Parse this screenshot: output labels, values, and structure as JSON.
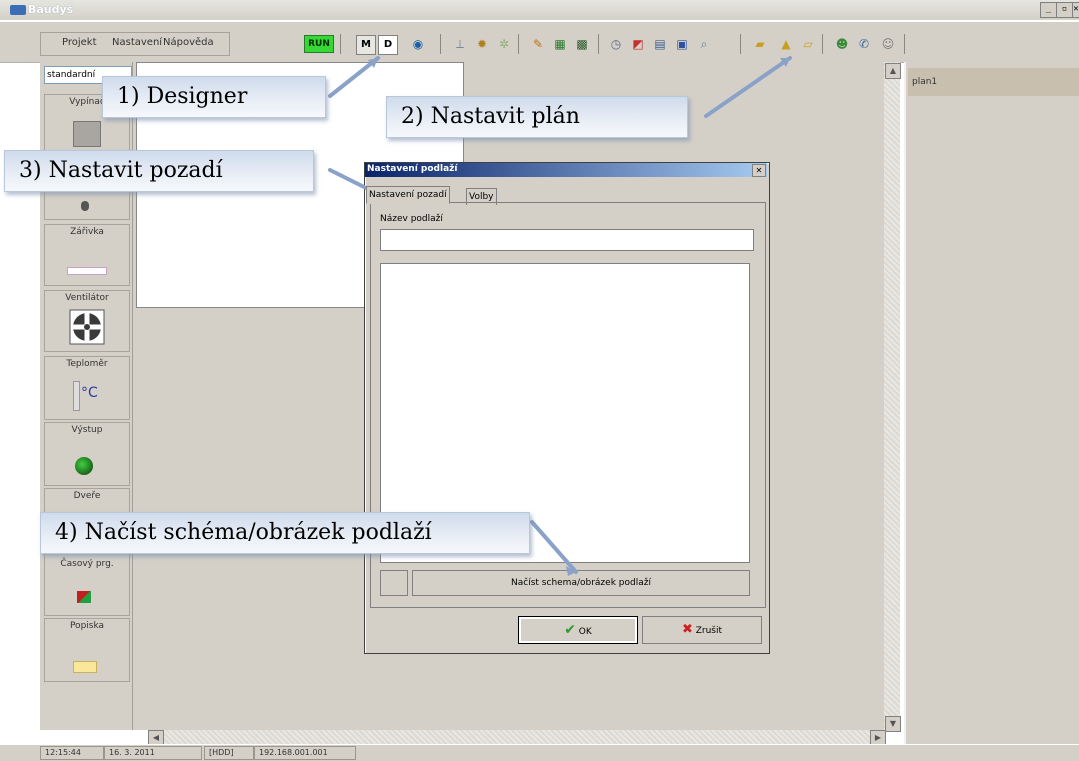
{
  "window": {
    "title": "Baudyš",
    "buttons": [
      "_",
      "▫",
      "✕"
    ]
  },
  "menu": {
    "items": [
      "Projekt",
      "Nastavení",
      "Nápověda"
    ]
  },
  "toolbar": {
    "run_label": "RUN",
    "m_label": "M",
    "d_label": "D"
  },
  "left_panel": {
    "dropdown_value": "standardní",
    "components": [
      {
        "label": "Vypínač",
        "icon": "switch-icon"
      },
      {
        "label": "",
        "icon": "bulb-icon"
      },
      {
        "label": "Zářivka",
        "icon": "fluorescent-lamp-icon"
      },
      {
        "label": "Ventilátor",
        "icon": "fan-icon"
      },
      {
        "label": "Teploměr",
        "icon": "thermometer-icon",
        "icon_text": "°C"
      },
      {
        "label": "Výstup",
        "icon": "output-led-icon"
      },
      {
        "label": "Dveře",
        "icon": "door-icon"
      },
      {
        "label": "Časový prg.",
        "icon": "timer-program-icon"
      },
      {
        "label": "Popiska",
        "icon": "label-icon"
      }
    ]
  },
  "right_panel": {
    "plans": [
      "plan1"
    ]
  },
  "status_bar": {
    "cells": [
      "12:15:44",
      "16. 3. 2011",
      "[HDD]",
      "192.168.001.001"
    ]
  },
  "dialog": {
    "title": "Nastavení podlaží",
    "tabs": [
      "Nastavení pozadí",
      "Volby"
    ],
    "floor_name_label": "Název podlaží",
    "floor_name_value": "",
    "load_button": "Načíst schema/obrázek podlaží",
    "ok_label": "OK",
    "cancel_label": "Zrušit"
  },
  "callouts": {
    "designer": "1) Designer",
    "set_plan": "2) Nastavit plán",
    "set_background": "3) Nastavit pozadí",
    "load_schema": "4) Načíst schéma/obrázek podlaží"
  },
  "colors": {
    "run_green": "#35d935",
    "dialog_title": "#0a246a",
    "callout_fill": "#dfe7f2",
    "arrow": "#8aa2c8"
  }
}
